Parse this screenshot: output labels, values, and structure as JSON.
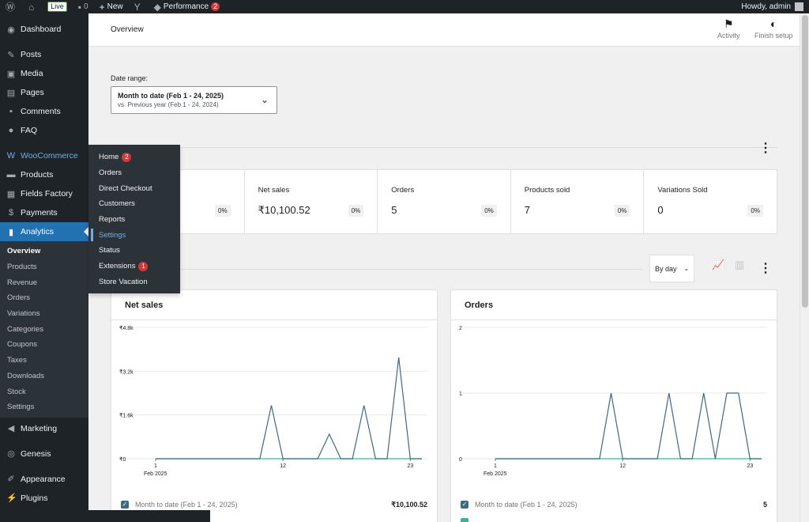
{
  "adminbar": {
    "live": "Live",
    "comments_count": "0",
    "new_label": "New",
    "performance_label": "Performance",
    "performance_badge": "2",
    "howdy": "Howdy, admin"
  },
  "sidebar": {
    "dashboard": "Dashboard",
    "posts": "Posts",
    "media": "Media",
    "pages": "Pages",
    "comments": "Comments",
    "faq": "FAQ",
    "woocommerce": "WooCommerce",
    "products": "Products",
    "fields_factory": "Fields Factory",
    "payments": "Payments",
    "analytics": "Analytics",
    "analytics_sub": [
      "Overview",
      "Products",
      "Revenue",
      "Orders",
      "Variations",
      "Categories",
      "Coupons",
      "Taxes",
      "Downloads",
      "Stock",
      "Settings"
    ],
    "marketing": "Marketing",
    "genesis": "Genesis",
    "appearance": "Appearance",
    "plugins": "Plugins"
  },
  "flyout": {
    "items": [
      "Home",
      "Orders",
      "Direct Checkout",
      "Customers",
      "Reports",
      "Settings",
      "Status",
      "Extensions",
      "Store Vacation"
    ],
    "home_badge": "2",
    "extensions_badge": "1"
  },
  "header": {
    "title": "Overview",
    "activity": "Activity",
    "finish_setup": "Finish setup"
  },
  "date_range": {
    "label": "Date range:",
    "primary": "Month to date (Feb 1 - 24, 2025)",
    "secondary": "vs. Previous year (Feb 1 - 24, 2024)"
  },
  "summary": [
    {
      "label": "",
      "value": "",
      "delta": "0%"
    },
    {
      "label": "Net sales",
      "value": "₹10,100.52",
      "delta": "0%"
    },
    {
      "label": "Orders",
      "value": "5",
      "delta": "0%"
    },
    {
      "label": "Products sold",
      "value": "7",
      "delta": "0%"
    },
    {
      "label": "Variations Sold",
      "value": "0",
      "delta": "0%"
    }
  ],
  "interval": "By day",
  "colors": {
    "series_current": "#3e6b80",
    "series_previous": "#3fb09a",
    "accent": "#2271b1"
  },
  "chart_data": [
    {
      "type": "line",
      "title": "Net sales",
      "x": [
        "Feb 1",
        "2",
        "3",
        "4",
        "5",
        "6",
        "7",
        "8",
        "9",
        "10",
        "11",
        "12",
        "13",
        "14",
        "15",
        "16",
        "17",
        "18",
        "19",
        "20",
        "21",
        "22",
        "23",
        "24"
      ],
      "x_tick_labels": [
        "1",
        "12",
        "23"
      ],
      "x_sublabel": "Feb 2025",
      "y_tick_labels": [
        "₹0",
        "₹1.6k",
        "₹3.2k",
        "₹4.8k"
      ],
      "ylim": [
        0,
        4800
      ],
      "series": [
        {
          "name": "Month to date (Feb 1 - 24, 2025)",
          "values": [
            0,
            0,
            0,
            0,
            0,
            0,
            0,
            0,
            0,
            0,
            1950,
            0,
            0,
            0,
            0,
            900,
            0,
            0,
            1950,
            0,
            0,
            3700,
            0,
            0
          ]
        },
        {
          "name": "",
          "values": [
            0,
            0,
            0,
            0,
            0,
            0,
            0,
            0,
            0,
            0,
            0,
            0,
            0,
            0,
            0,
            0,
            0,
            0,
            0,
            0,
            0,
            0,
            0,
            0
          ]
        }
      ],
      "legend": [
        {
          "label": "Month to date (Feb 1 - 24, 2025)",
          "value": "₹10,100.52"
        },
        {
          "label": "",
          "value": ""
        }
      ]
    },
    {
      "type": "line",
      "title": "Orders",
      "x": [
        "Feb 1",
        "2",
        "3",
        "4",
        "5",
        "6",
        "7",
        "8",
        "9",
        "10",
        "11",
        "12",
        "13",
        "14",
        "15",
        "16",
        "17",
        "18",
        "19",
        "20",
        "21",
        "22",
        "23",
        "24"
      ],
      "x_tick_labels": [
        "1",
        "12",
        "23"
      ],
      "x_sublabel": "Feb 2025",
      "y_tick_labels": [
        "0",
        "1",
        "2"
      ],
      "ylim": [
        0,
        2
      ],
      "series": [
        {
          "name": "Month to date (Feb 1 - 24, 2025)",
          "values": [
            0,
            0,
            0,
            0,
            0,
            0,
            0,
            0,
            0,
            0,
            1,
            0,
            0,
            0,
            0,
            1,
            0,
            0,
            1,
            0,
            1,
            1,
            0,
            0
          ]
        },
        {
          "name": "",
          "values": [
            0,
            0,
            0,
            0,
            0,
            0,
            0,
            0,
            0,
            0,
            0,
            0,
            0,
            0,
            0,
            0,
            0,
            0,
            0,
            0,
            0,
            0,
            0,
            0
          ]
        }
      ],
      "legend": [
        {
          "label": "Month to date (Feb 1 - 24, 2025)",
          "value": "5"
        },
        {
          "label": "",
          "value": ""
        }
      ]
    }
  ]
}
